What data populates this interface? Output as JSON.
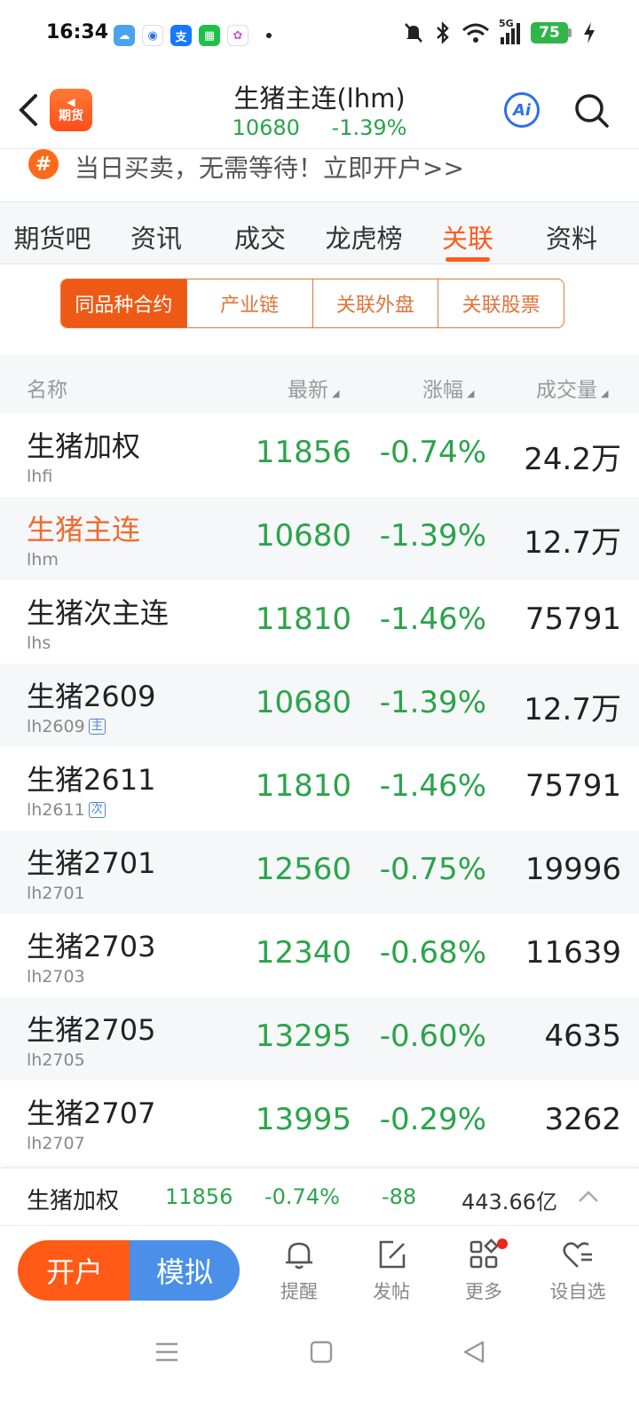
{
  "status_bar": {
    "time": "16:34",
    "app_icons": [
      "weather-icon",
      "baidu-icon",
      "alipay-icon",
      "wechat-pay-icon",
      "gallery-icon"
    ],
    "signal_label": "5G",
    "battery": "75"
  },
  "header": {
    "logo_text": "期货",
    "title": "生猪主连(lhm)",
    "price": "10680",
    "change": "-1.39%",
    "ai_label": "Ai"
  },
  "promo": {
    "icon": "#",
    "text": "当日买卖，无需等待！立即开户>>"
  },
  "tabs": [
    {
      "label": "期货吧"
    },
    {
      "label": "资讯"
    },
    {
      "label": "成交"
    },
    {
      "label": "龙虎榜"
    },
    {
      "label": "关联",
      "active": true
    },
    {
      "label": "资料"
    }
  ],
  "segments": [
    {
      "label": "同品种合约",
      "active": true
    },
    {
      "label": "产业链"
    },
    {
      "label": "关联外盘"
    },
    {
      "label": "关联股票"
    }
  ],
  "table": {
    "headers": {
      "name": "名称",
      "latest": "最新",
      "change": "涨幅",
      "volume": "成交量"
    },
    "rows": [
      {
        "name": "生猪加权",
        "code": "lhfi",
        "tag": "",
        "price": "11856",
        "change": "-0.74%",
        "volume": "24.2万"
      },
      {
        "name": "生猪主连",
        "code": "lhm",
        "tag": "",
        "price": "10680",
        "change": "-1.39%",
        "volume": "12.7万",
        "current": true
      },
      {
        "name": "生猪次主连",
        "code": "lhs",
        "tag": "",
        "price": "11810",
        "change": "-1.46%",
        "volume": "75791"
      },
      {
        "name": "生猪2609",
        "code": "lh2609",
        "tag": "主",
        "price": "10680",
        "change": "-1.39%",
        "volume": "12.7万"
      },
      {
        "name": "生猪2611",
        "code": "lh2611",
        "tag": "次",
        "price": "11810",
        "change": "-1.46%",
        "volume": "75791"
      },
      {
        "name": "生猪2701",
        "code": "lh2701",
        "tag": "",
        "price": "12560",
        "change": "-0.75%",
        "volume": "19996"
      },
      {
        "name": "生猪2703",
        "code": "lh2703",
        "tag": "",
        "price": "12340",
        "change": "-0.68%",
        "volume": "11639"
      },
      {
        "name": "生猪2705",
        "code": "lh2705",
        "tag": "",
        "price": "13295",
        "change": "-0.60%",
        "volume": "4635"
      },
      {
        "name": "生猪2707",
        "code": "lh2707",
        "tag": "",
        "price": "13995",
        "change": "-0.29%",
        "volume": "3262"
      }
    ]
  },
  "ticker": {
    "name": "生猪加权",
    "price": "11856",
    "change": "-0.74%",
    "diff": "-88",
    "amount": "443.66亿"
  },
  "bottom_bar": {
    "open_label": "开户",
    "sim_label": "模拟",
    "items": [
      {
        "label": "提醒",
        "icon": "bell-icon"
      },
      {
        "label": "发帖",
        "icon": "edit-icon"
      },
      {
        "label": "更多",
        "icon": "grid-icon"
      },
      {
        "label": "设自选",
        "icon": "heart-list-icon"
      }
    ]
  },
  "colors": {
    "accent": "#ff5a1f",
    "down": "#2aa44a",
    "blue": "#4a90e8"
  }
}
